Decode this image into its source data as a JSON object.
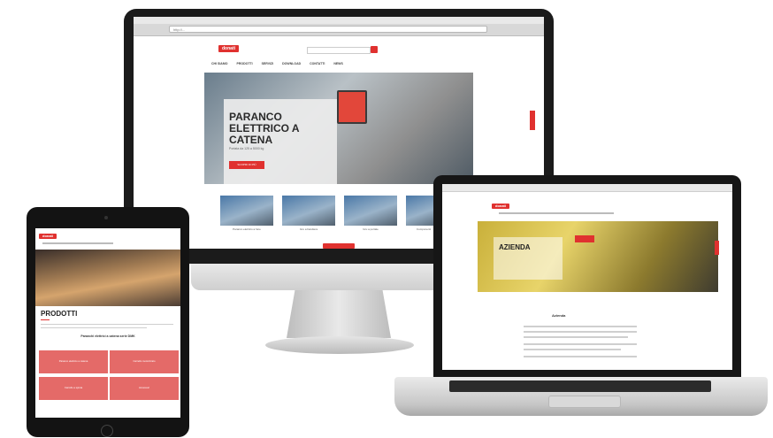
{
  "imac": {
    "url": "http://...",
    "logo": "donati",
    "nav": [
      "CHI SIAMO",
      "PRODOTTI",
      "SERVIZI",
      "DOWNLOAD",
      "CONTATTI",
      "NEWS"
    ],
    "hero_title": "PARANCO ELETTRICO A CATENA",
    "hero_subtitle": "Portata da 125 a 5000 kg",
    "hero_button": "SCOPRI DI PIÙ",
    "thumbnails": [
      "Paranco elettrico a fune",
      "Gru a bandiera",
      "Gru a portale",
      "Componenti"
    ]
  },
  "laptop": {
    "logo": "donati",
    "hero_title": "AZIENDA",
    "heading": "Azienda"
  },
  "tablet": {
    "logo": "donati",
    "page_title": "PRODOTTI",
    "section_title": "Paranchi elettrici a catena serie DMK",
    "tiles": [
      "Paranco elettrico a catena",
      "Carrello motorizzato",
      "Carrello a spinta",
      "Accessori"
    ]
  },
  "colors": {
    "brand_red": "#e0312f",
    "tile_red": "#e46a68"
  }
}
